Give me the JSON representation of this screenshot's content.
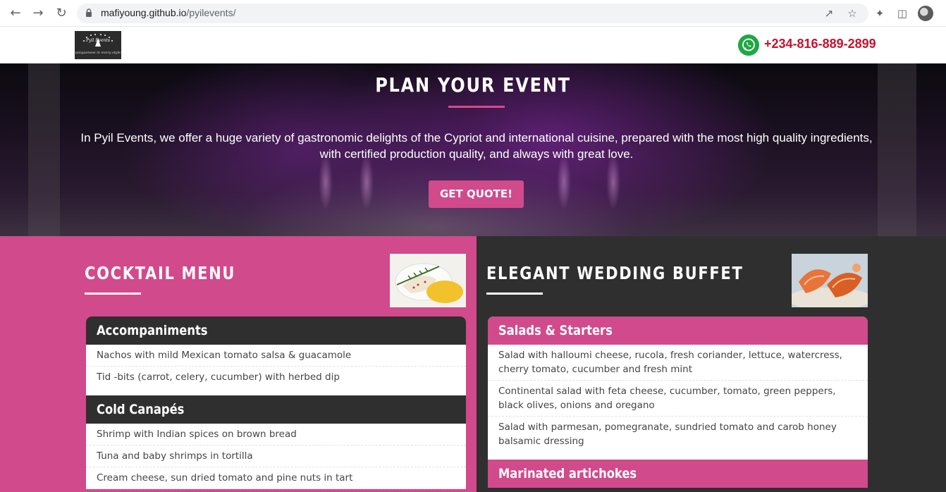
{
  "browser": {
    "url_host": "mafiyoung.github.io",
    "url_path": "/pyilevents/"
  },
  "header": {
    "logo_line1": "Pyil Events",
    "logo_line2": "uniqueness in every style",
    "phone": "+234-816-889-2899"
  },
  "hero": {
    "title": "PLAN YOUR EVENT",
    "text": "In Pyil Events, we offer a huge variety of gastronomic delights of the Cypriot and international cuisine, prepared with the most high quality ingredients, with certified production quality, and always with great love.",
    "button": "GET QUOTE!"
  },
  "cocktail": {
    "title": "COCKTAIL MENU",
    "sections": [
      {
        "heading": "Accompaniments",
        "items": [
          "Nachos with mild Mexican tomato salsa & guacamole",
          "Tid -bits (carrot, celery, cucumber) with herbed dip"
        ]
      },
      {
        "heading": "Cold Canapés",
        "items": [
          "Shrimp with Indian spices on brown bread",
          "Tuna and baby shrimps in tortilla",
          "Cream cheese, sun dried tomato and pine nuts in tart"
        ]
      }
    ]
  },
  "buffet": {
    "title": "ELEGANT WEDDING BUFFET",
    "sections": [
      {
        "heading": "Salads & Starters",
        "items": [
          "Salad with halloumi cheese, rucola, fresh coriander, lettuce, watercress, cherry tomato, cucumber and fresh mint",
          "Continental salad with feta cheese, cucumber, tomato, green peppers, black olives, onions and oregano",
          "Salad with parmesan, pomegranate, sundried tomato and carob honey balsamic dressing"
        ]
      },
      {
        "heading": "Marinated artichokes",
        "items": []
      }
    ]
  },
  "colors": {
    "accent_pink": "#d14a8b",
    "dark": "#2f2f2f",
    "phone_red": "#c8102e",
    "whatsapp_green": "#1fa843"
  }
}
